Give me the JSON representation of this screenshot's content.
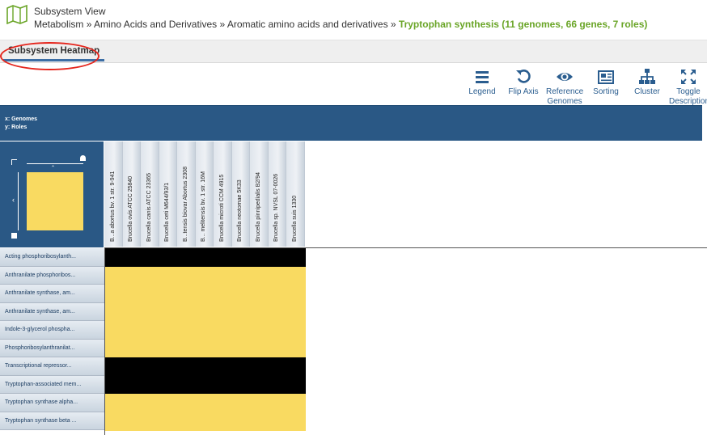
{
  "header": {
    "title": "Subsystem View",
    "breadcrumb": [
      "Metabolism",
      "Amino Acids and Derivatives",
      "Aromatic amino acids and derivatives"
    ],
    "breadcrumb_sep": " » ",
    "current": "Tryptophan synthesis (11 genomes, 66 genes, 7 roles)"
  },
  "tabs": {
    "active_label": "Subsystem Heatmap"
  },
  "toolbar": [
    {
      "id": "legend",
      "label1": "Legend",
      "label2": "",
      "icon": "list-icon"
    },
    {
      "id": "flip-axis",
      "label1": "Flip Axis",
      "label2": "",
      "icon": "rotate-icon"
    },
    {
      "id": "reference-genomes",
      "label1": "Reference",
      "label2": "Genomes",
      "icon": "eye-icon"
    },
    {
      "id": "sorting",
      "label1": "Sorting",
      "label2": "",
      "icon": "newspaper-icon"
    },
    {
      "id": "cluster",
      "label1": "Cluster",
      "label2": "",
      "icon": "sitemap-icon"
    },
    {
      "id": "toggle-description",
      "label1": "Toggle",
      "label2": "Description",
      "icon": "expand-icon"
    }
  ],
  "axis": {
    "x": "x: Genomes",
    "y": "y: Roles"
  },
  "columns": [
    "B...a abortus bv. 1 str. 9-941",
    "Brucella ovis ATCC 25840",
    "Brucella canis ATCC 23365",
    "Brucella ceti M644/93/1",
    "B...tensis biovar Abortus 2308",
    "B... melitensis bv. 1 str. 16M",
    "Brucella microti CCM 4915",
    "Brucella neotomae 5K33",
    "Brucella pinnipedialis B2/94",
    "Brucella sp. NVSL 07-0026",
    "Brucella suis 1330"
  ],
  "rows": [
    "Acting phosphoribosylanth...",
    "Anthranilate phosphoribos...",
    "Anthranilate synthase, am...",
    "Anthranilate synthase, am...",
    "Indole-3-glycerol phospha...",
    "Phosphoribosylanthranilat...",
    "Transcriptional repressor...",
    "Tryptophan-associated mem...",
    "Tryptophan synthase alpha...",
    "Tryptophan synthase beta ..."
  ],
  "row_states": [
    "absent",
    "present",
    "present",
    "present",
    "present",
    "present",
    "absent",
    "absent",
    "present",
    "present"
  ],
  "colors": {
    "present": "#f9da61",
    "absent": "#000000",
    "accent": "#2a5885",
    "breadcrumb_current": "#6aa527",
    "highlight_circle": "#e5261d"
  }
}
